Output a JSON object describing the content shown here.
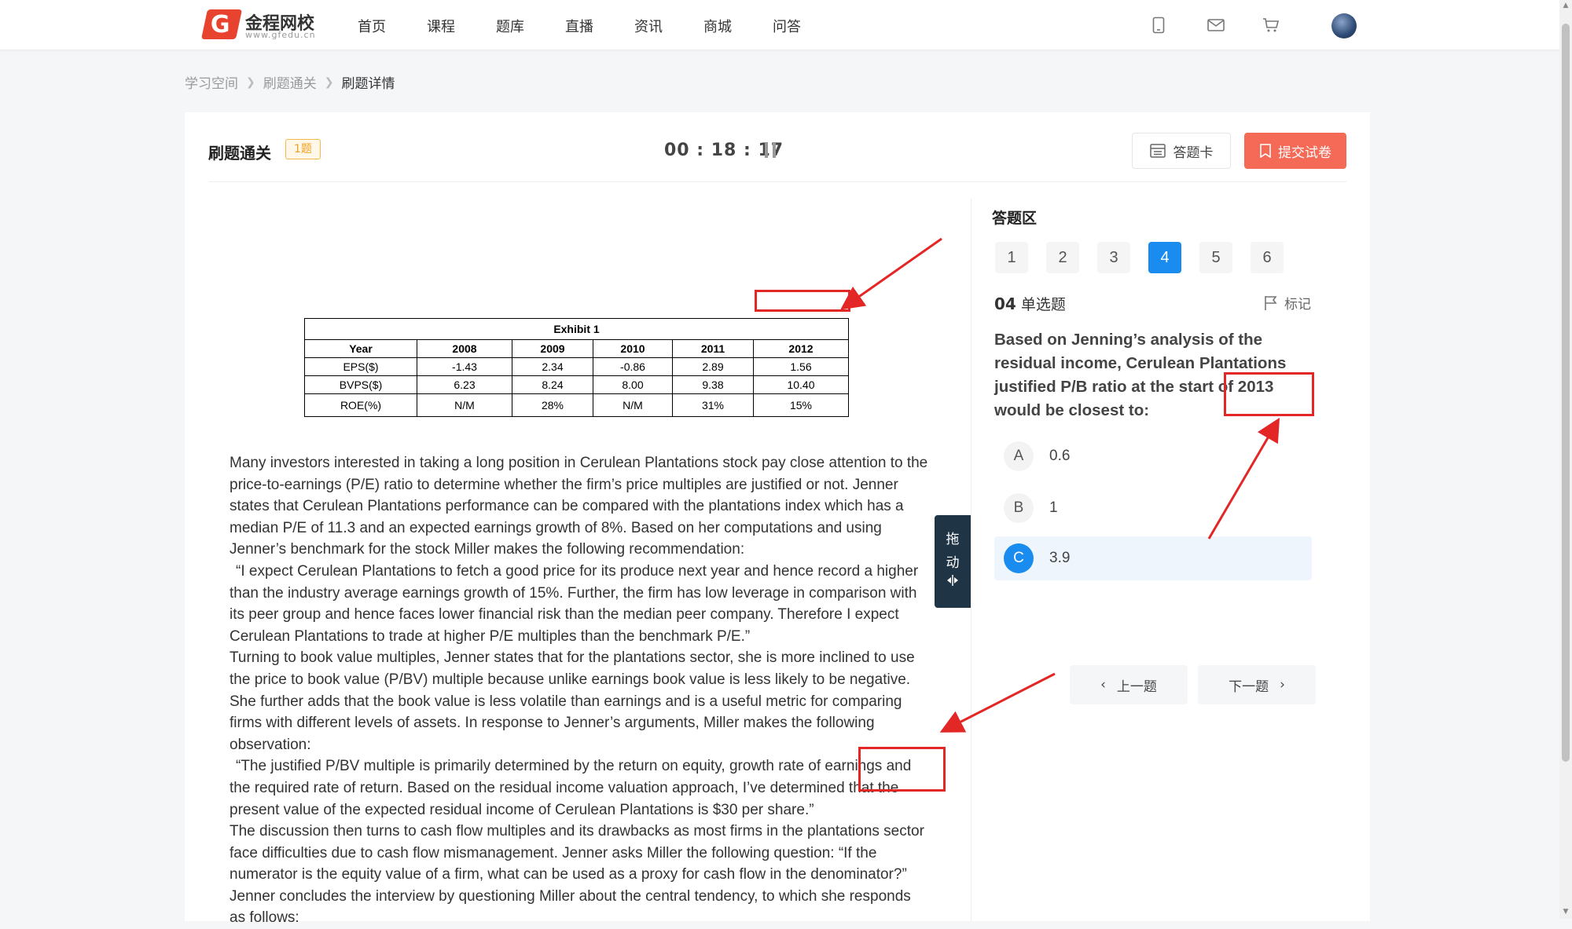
{
  "brand": {
    "name": "金程网校",
    "url": "www.gfedu.cn",
    "mark": "G"
  },
  "nav": [
    "首页",
    "课程",
    "题库",
    "直播",
    "资讯",
    "商城",
    "问答"
  ],
  "breadcrumb": [
    "学习空间",
    "刷题通关",
    "刷题详情"
  ],
  "header": {
    "title": "刷题通关",
    "count_badge": "1题",
    "timer": "00 : 18 : 17",
    "answer_card_label": "答题卡",
    "submit_label": "提交试卷"
  },
  "exhibit": {
    "title": "Exhibit 1",
    "columns": [
      "Year",
      "2008",
      "2009",
      "2010",
      "2011",
      "2012"
    ],
    "rows": [
      [
        "EPS($)",
        "-1.43",
        "2.34",
        "-0.86",
        "2.89",
        "1.56"
      ],
      [
        "BVPS($)",
        "6.23",
        "8.24",
        "8.00",
        "9.38",
        "10.40"
      ],
      [
        "ROE(%)",
        "N/M",
        "28%",
        "N/M",
        "31%",
        "15%"
      ]
    ]
  },
  "passage": [
    "Many investors interested in taking a long position in Cerulean Plantations stock pay close attention to the price-to-earnings (P/E) ratio to determine whether the firm’s price multiples are justified or not. Jenner states that Cerulean Plantations performance can be compared with the plantations index which has a median P/E of 11.3 and an expected earnings growth of 8%. Based on her computations and using Jenner’s benchmark for the stock Miller makes the following recommendation:",
    "“I expect Cerulean Plantations to fetch a good price for its produce next year and hence record a higher than the industry average earnings growth of 15%. Further, the firm has low leverage in comparison with its peer group and hence faces lower financial risk than the median peer company. Therefore I expect Cerulean Plantations to trade at higher P/E multiples than the benchmark P/E.”",
    "Turning to book value multiples, Jenner states that for the plantations sector, she is more inclined to use the price to book value (P/BV) multiple because unlike earnings book value is less likely to be negative. She further adds that the book value is less volatile than earnings and is a useful metric for comparing firms with different levels of assets. In response to Jenner’s arguments, Miller makes the following observation:",
    "“The justified P/BV multiple is primarily determined by the return on equity, growth rate of earnings and the required rate of return. Based on the residual income valuation approach, I’ve determined that the present value of the expected residual income of Cerulean Plantations is $30 per share.”",
    "The discussion then turns to cash flow multiples and its drawbacks as most firms in the plantations sector face difficulties due to cash flow mismanagement. Jenner asks Miller the following question: “If the numerator is the equity value of a firm, what can be used as a proxy for cash flow in the denominator?”",
    "Jenner concludes the interview by questioning Miller about the central tendency, to which she responds as follows:"
  ],
  "drag_tab": [
    "拖",
    "动"
  ],
  "answer_zone": {
    "title": "答题区",
    "question_numbers": [
      "1",
      "2",
      "3",
      "4",
      "5",
      "6"
    ],
    "active_number": "4",
    "question_index": "04",
    "question_type": "单选题",
    "mark_label": "标记",
    "stem": "Based on Jenning’s analysis of the residual income, Cerulean Plantations justified P/B ratio at the start of 2013 would be closest to:",
    "options": [
      {
        "letter": "A",
        "text": "0.6",
        "selected": false
      },
      {
        "letter": "B",
        "text": "1",
        "selected": false
      },
      {
        "letter": "C",
        "text": "3.9",
        "selected": true
      }
    ],
    "prev_label": "上一题",
    "next_label": "下一题"
  },
  "colors": {
    "accent": "#1a8cf0",
    "submit": "#f46a57",
    "annotation": "#e32626"
  }
}
